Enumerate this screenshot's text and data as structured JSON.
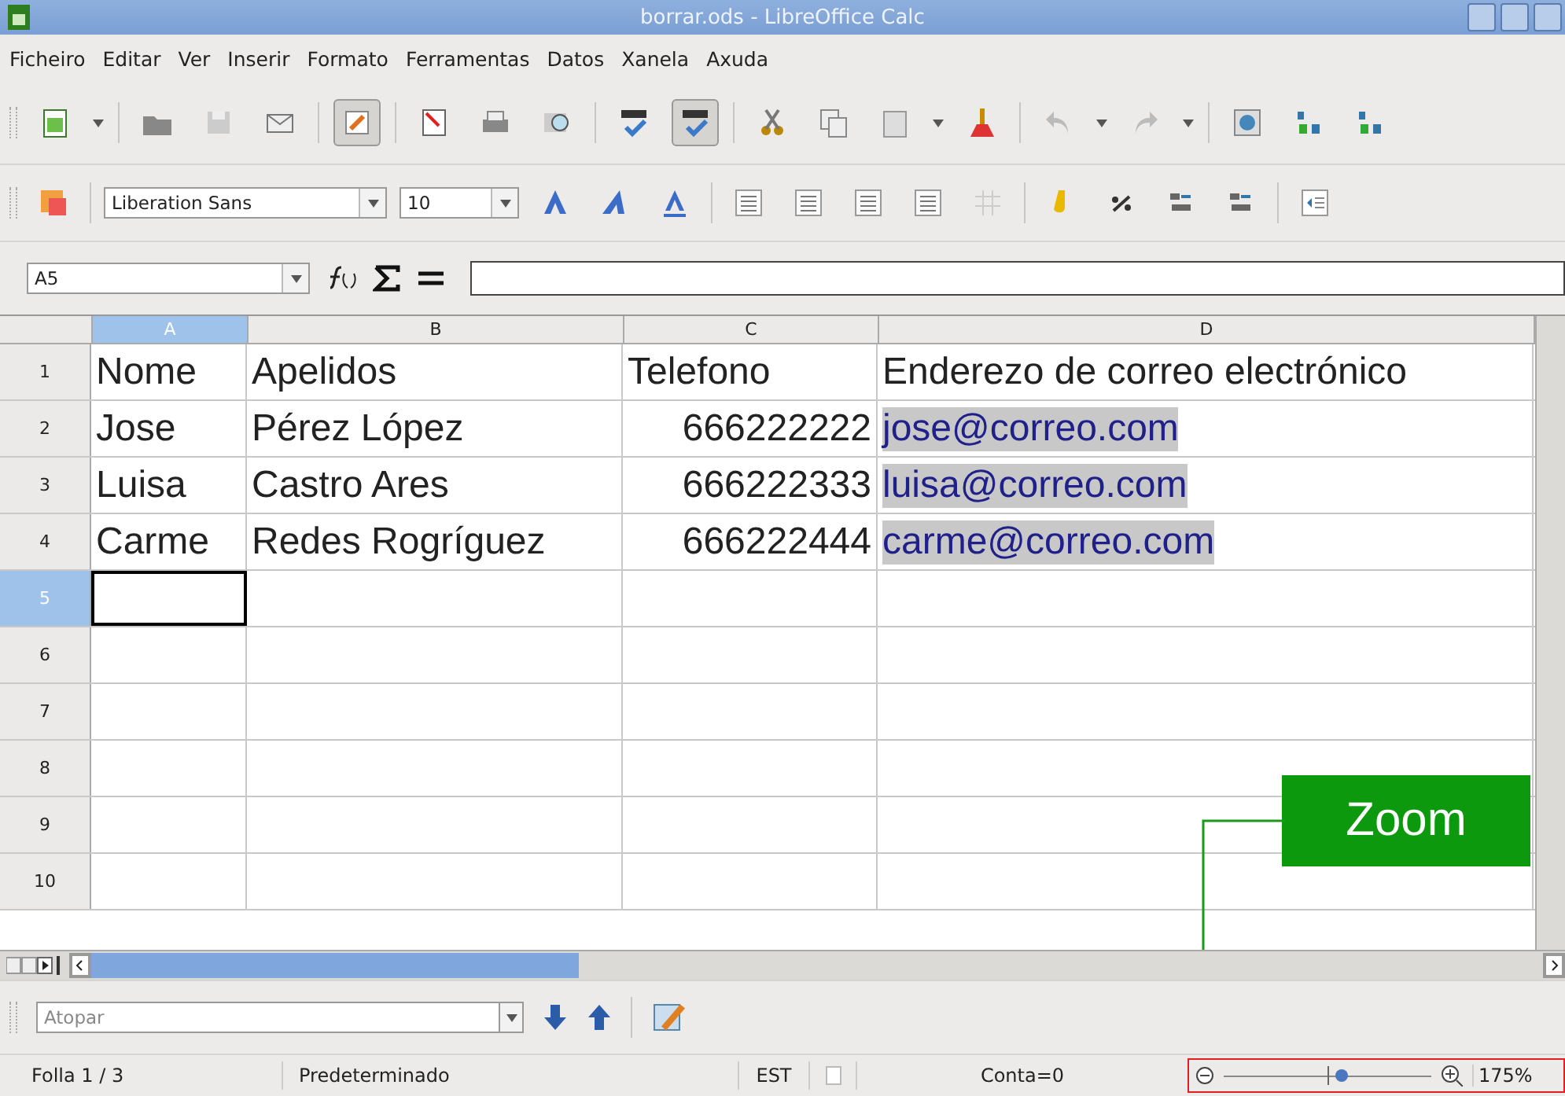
{
  "window": {
    "title": "borrar.ods - LibreOffice Calc"
  },
  "menu": [
    "Ficheiro",
    "Editar",
    "Ver",
    "Inserir",
    "Formato",
    "Ferramentas",
    "Datos",
    "Xanela",
    "Axuda"
  ],
  "toolbar": {
    "edit_mode": true,
    "auto_spellcheck": true
  },
  "format_bar": {
    "font": "Liberation Sans",
    "size": "10"
  },
  "formula_bar": {
    "name_box": "A5"
  },
  "sheet": {
    "columns": [
      {
        "label": "A",
        "selected": true
      },
      {
        "label": "B",
        "selected": false
      },
      {
        "label": "C",
        "selected": false
      },
      {
        "label": "D",
        "selected": false
      }
    ],
    "rows": [
      {
        "number": "1",
        "selected": false,
        "cells": [
          {
            "text": "Nome",
            "kind": "text"
          },
          {
            "text": "Apelidos",
            "kind": "text"
          },
          {
            "text": "Telefono",
            "kind": "text"
          },
          {
            "text": "Enderezo de correo electrónico",
            "kind": "text"
          }
        ]
      },
      {
        "number": "2",
        "selected": false,
        "cells": [
          {
            "text": "Jose",
            "kind": "text"
          },
          {
            "text": "Pérez López",
            "kind": "text"
          },
          {
            "text": "666222222",
            "kind": "number"
          },
          {
            "text": "jose@correo.com",
            "kind": "link"
          }
        ]
      },
      {
        "number": "3",
        "selected": false,
        "cells": [
          {
            "text": "Luisa",
            "kind": "text"
          },
          {
            "text": "Castro Ares",
            "kind": "text"
          },
          {
            "text": "666222333",
            "kind": "number"
          },
          {
            "text": "luisa@correo.com",
            "kind": "link"
          }
        ]
      },
      {
        "number": "4",
        "selected": false,
        "cells": [
          {
            "text": "Carme",
            "kind": "text"
          },
          {
            "text": "Redes Rogríguez",
            "kind": "text"
          },
          {
            "text": "666222444",
            "kind": "number"
          },
          {
            "text": "carme@correo.com",
            "kind": "link"
          }
        ]
      },
      {
        "number": "5",
        "selected": true
      },
      {
        "number": "6",
        "selected": false
      },
      {
        "number": "7",
        "selected": false
      },
      {
        "number": "8",
        "selected": false
      },
      {
        "number": "9",
        "selected": false
      },
      {
        "number": "10",
        "selected": false
      }
    ]
  },
  "find_bar": {
    "placeholder": "Atopar"
  },
  "status_bar": {
    "sheet": "Folla 1 / 3",
    "style": "Predeterminado",
    "mode": "EST",
    "sum": "Conta=0",
    "zoom_slider": {
      "level": 0.57
    },
    "zoom": "175%"
  },
  "callout": {
    "label": "Zoom"
  }
}
